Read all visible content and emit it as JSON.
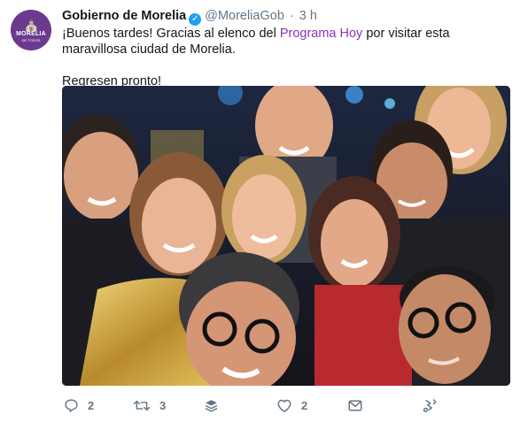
{
  "tweet": {
    "avatar": {
      "brand": "MORELIA",
      "sub": "DE TODOS"
    },
    "author": {
      "display_name": "Gobierno de Morelia",
      "handle": "@MoreliaGob",
      "separator": "·",
      "time": "3 h"
    },
    "text": {
      "before_link": "¡Buenos tardes! Gracias al elenco del ",
      "link": "Programa Hoy",
      "after_link": " por visitar esta maravillosa ciudad de Morelia.",
      "second_line": "Regresen pronto!"
    },
    "actions": {
      "reply_count": "2",
      "retweet_count": "3",
      "like_count": "2"
    }
  },
  "colors": {
    "link": "#8a33b8",
    "verified": "#1da1f2",
    "muted": "#657786",
    "avatar_bg": "#6b3a8e"
  },
  "icons": [
    "reply-icon",
    "retweet-icon",
    "stack-icon",
    "like-icon",
    "message-icon",
    "analytics-icon",
    "verified-icon"
  ]
}
